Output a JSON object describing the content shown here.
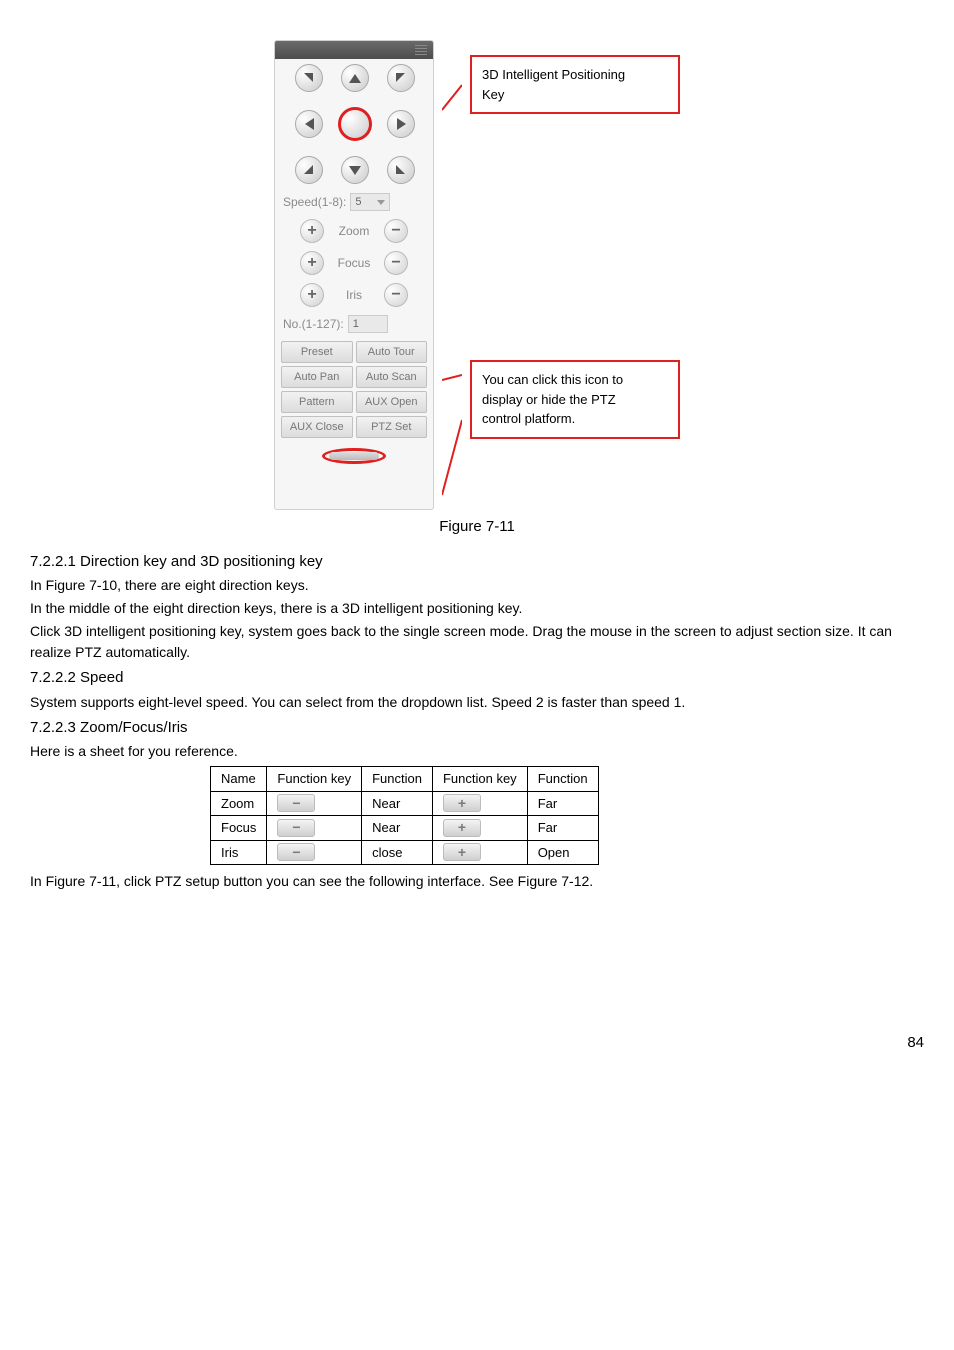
{
  "figure": {
    "callout1_l1": "3D Intelligent Positioning",
    "callout1_l2": "Key",
    "callout2_l1": "You can click this icon to",
    "callout2_l2": "display or hide the PTZ",
    "callout2_l3": "control platform.",
    "speed_label": "Speed(1-8):",
    "speed_value": "5",
    "zoom_label": "Zoom",
    "focus_label": "Focus",
    "iris_label": "Iris",
    "no_label": "No.(1-127):",
    "no_value": "1",
    "preset": "Preset",
    "autotour": "Auto Tour",
    "autopan": "Auto Pan",
    "autoscan": "Auto Scan",
    "pattern": "Pattern",
    "auxopen": "AUX Open",
    "auxclose": "AUX Close",
    "ptzset": "PTZ Set",
    "caption": "Figure 7-11"
  },
  "sec1_h": "7.2.2.1  Direction key and 3D positioning key",
  "sec1_p1": "In Figure 7-10, there are eight direction keys.",
  "sec1_p2": "In the middle of the eight direction keys, there is a 3D intelligent positioning key.",
  "sec1_p3": "Click 3D intelligent positioning key, system goes back to the single screen mode. Drag the mouse in the screen to adjust section size. It can realize PTZ automatically.",
  "sec2_h": "7.2.2.2  Speed",
  "sec2_p1": "System supports eight-level speed. You can select from the dropdown list. Speed 2 is faster than speed 1.",
  "sec3_h": "7.2.2.3  Zoom/Focus/Iris",
  "sec3_p1": "Here is a sheet for you reference.",
  "table": {
    "h1": "Name",
    "h2": "Function key",
    "h3": "Function",
    "h4": "Function key",
    "h5": "Function",
    "r1c1": "Zoom",
    "r1c3": "Near",
    "r1c5": "Far",
    "r2c1": "Focus",
    "r2c3": "Near",
    "r2c5": "Far",
    "r3c1": "Iris",
    "r3c3": "close",
    "r3c5": "Open"
  },
  "after_table": "In Figure 7-11, click PTZ setup button you can see the following interface. See Figure 7-12.",
  "page_no": "84",
  "chart_data": {
    "type": "table",
    "title": "Zoom/Focus/Iris reference",
    "columns": [
      "Name",
      "Function key",
      "Function",
      "Function key",
      "Function"
    ],
    "rows": [
      [
        "Zoom",
        "minus-key",
        "Near",
        "plus-key",
        "Far"
      ],
      [
        "Focus",
        "minus-key",
        "Near",
        "plus-key",
        "Far"
      ],
      [
        "Iris",
        "minus-key",
        "close",
        "plus-key",
        "Open"
      ]
    ]
  }
}
